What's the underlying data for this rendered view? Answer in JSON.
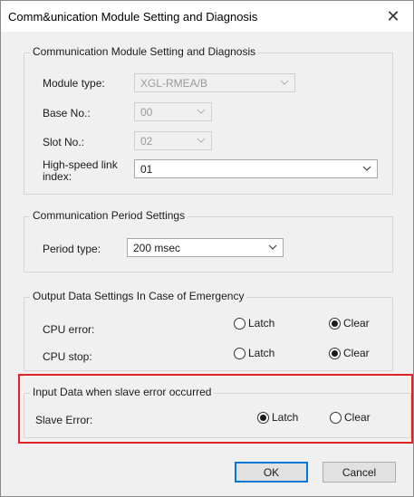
{
  "window": {
    "title": "Comm&unication Module Setting and Diagnosis",
    "close_glyph": "✕"
  },
  "module_group": {
    "title": "Communication Module Setting and Diagnosis",
    "module_type_label": "Module type:",
    "module_type_value": "XGL-RMEA/B",
    "base_no_label": "Base No.:",
    "base_no_value": "00",
    "slot_no_label": "Slot No.:",
    "slot_no_value": "02",
    "hs_link_label_line1": "High-speed link",
    "hs_link_label_line2": "index:",
    "hs_link_value": "01"
  },
  "period_group": {
    "title": "Communication Period Settings",
    "period_type_label": "Period type:",
    "period_type_value": "200 msec"
  },
  "emergency_group": {
    "title": "Output Data Settings In Case of Emergency",
    "rows": [
      {
        "label": "CPU error:",
        "latch_label": "Latch",
        "clear_label": "Clear",
        "selected": "Clear"
      },
      {
        "label": "CPU stop:",
        "latch_label": "Latch",
        "clear_label": "Clear",
        "selected": "Clear"
      }
    ]
  },
  "slave_group": {
    "title": "Input Data when slave error occurred",
    "label": "Slave Error:",
    "latch_label": "Latch",
    "clear_label": "Clear",
    "selected": "Latch"
  },
  "buttons": {
    "ok": "OK",
    "cancel": "Cancel"
  },
  "colors": {
    "highlight_border": "#e02424",
    "default_button_border": "#0078d7"
  },
  "icons": {
    "dropdown": "chevron-down-icon",
    "close": "close-icon"
  }
}
